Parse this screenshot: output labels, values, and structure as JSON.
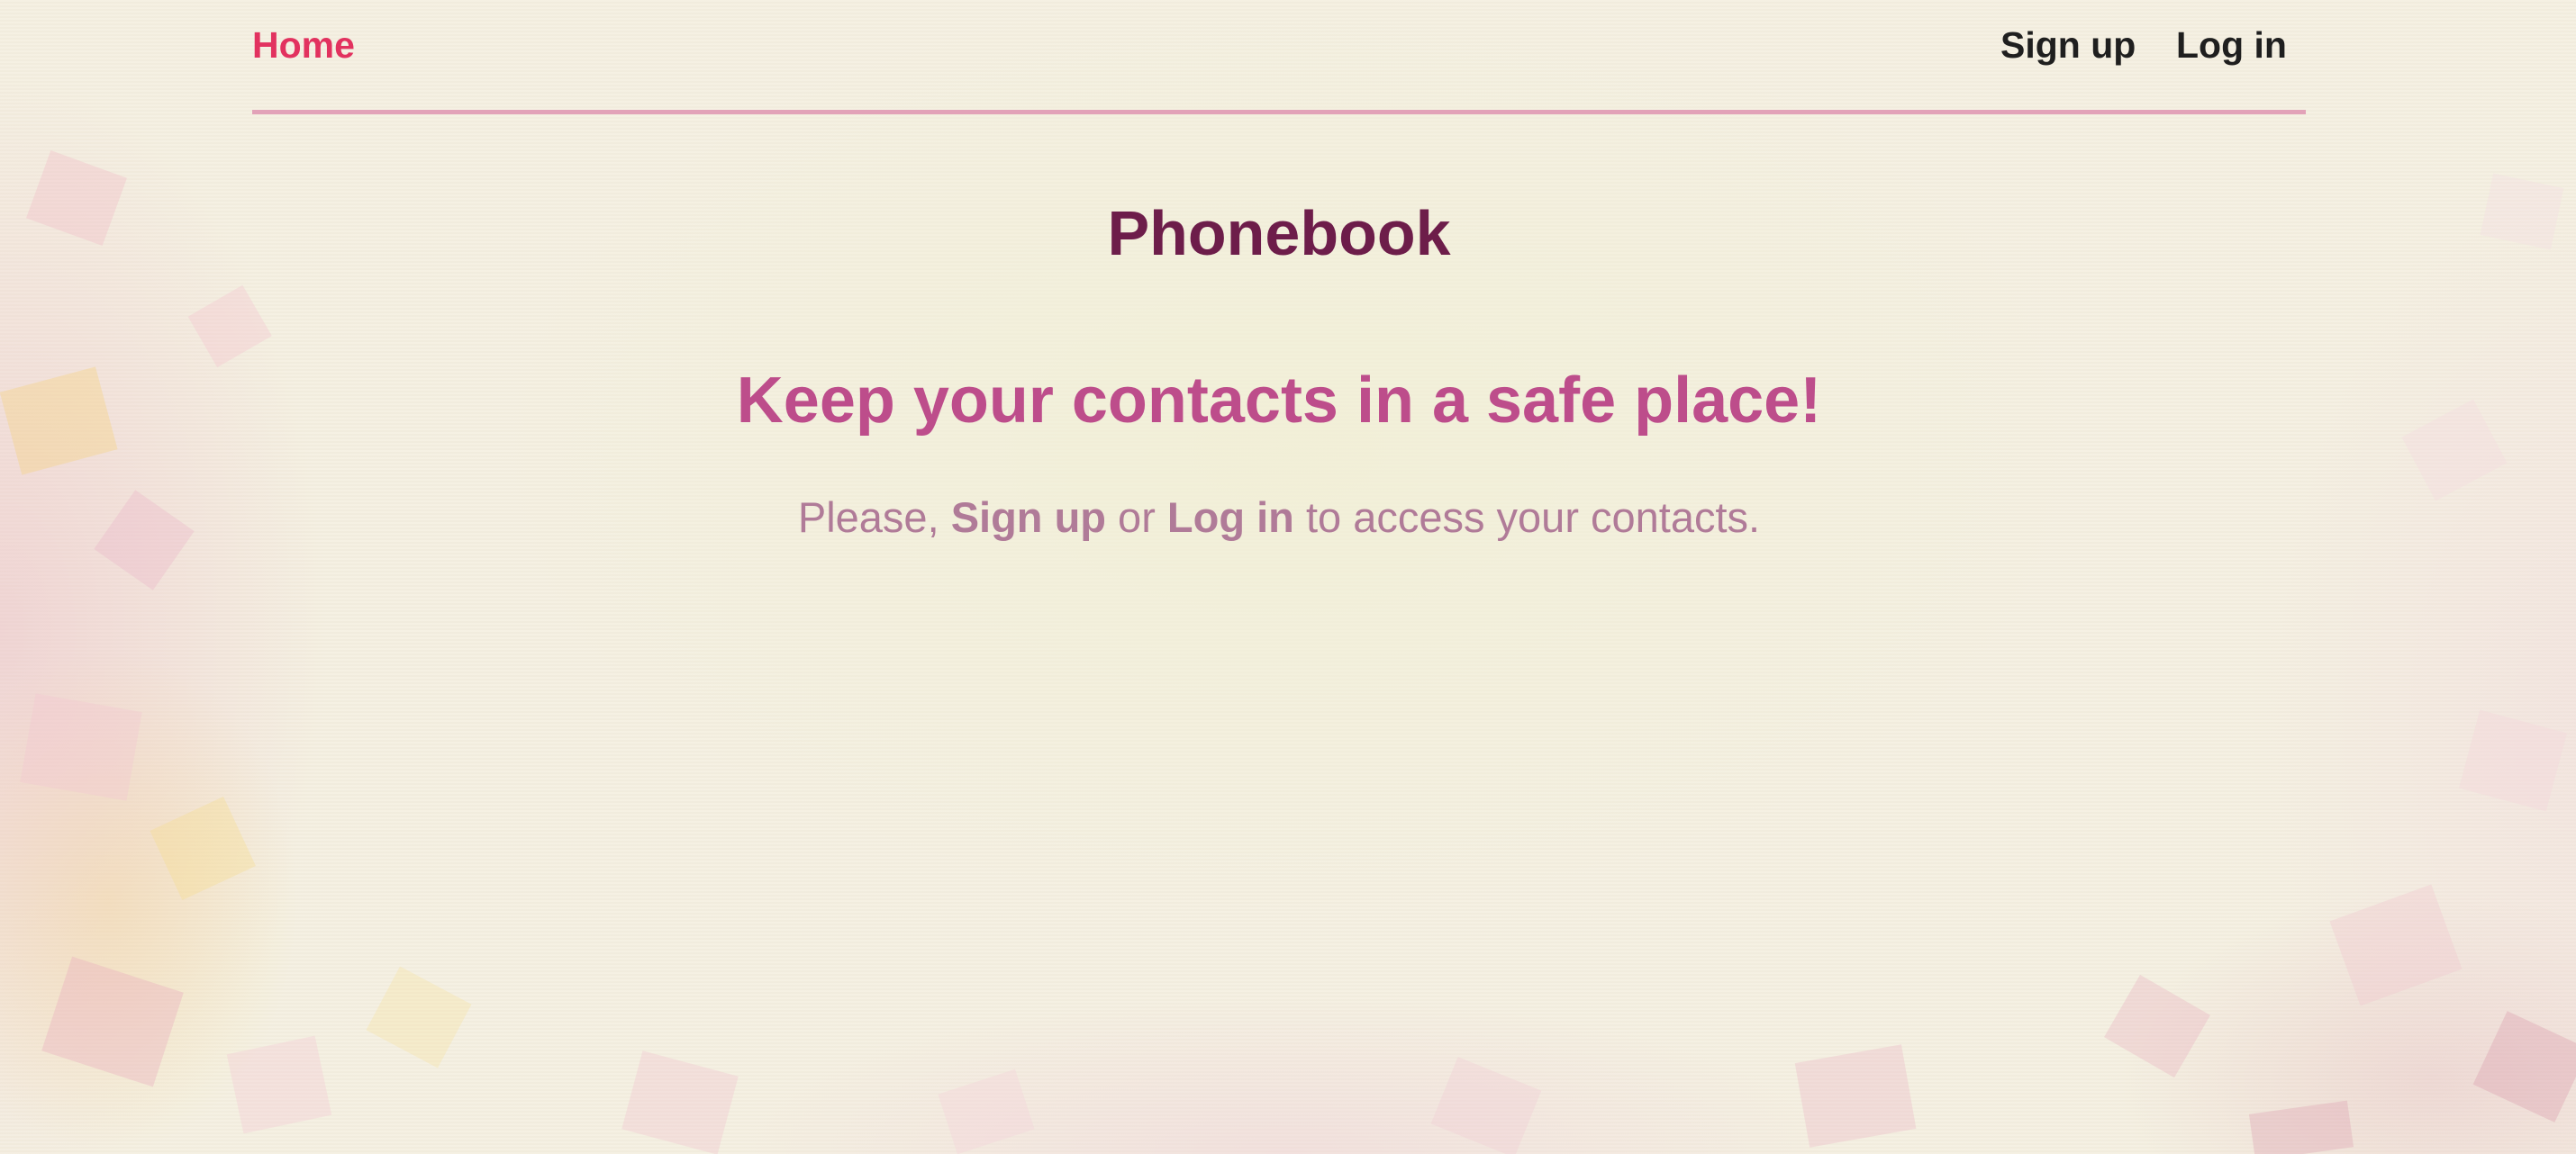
{
  "nav": {
    "home_label": "Home",
    "signup_label": "Sign up",
    "login_label": "Log in"
  },
  "main": {
    "title": "Phonebook",
    "tagline": "Keep your contacts in a safe place!",
    "prompt_start": "Please, ",
    "prompt_signup": "Sign up",
    "prompt_or": " or ",
    "prompt_login": "Log in",
    "prompt_end": " to access your contacts."
  },
  "colors": {
    "home_link": "#e2325f",
    "nav_link": "#1f1f1f",
    "nav_divider": "#e2a2b8",
    "title": "#6d1d4a",
    "tagline": "#bd4d8b",
    "prompt": "#b07b98",
    "background": "#f4efe0"
  }
}
